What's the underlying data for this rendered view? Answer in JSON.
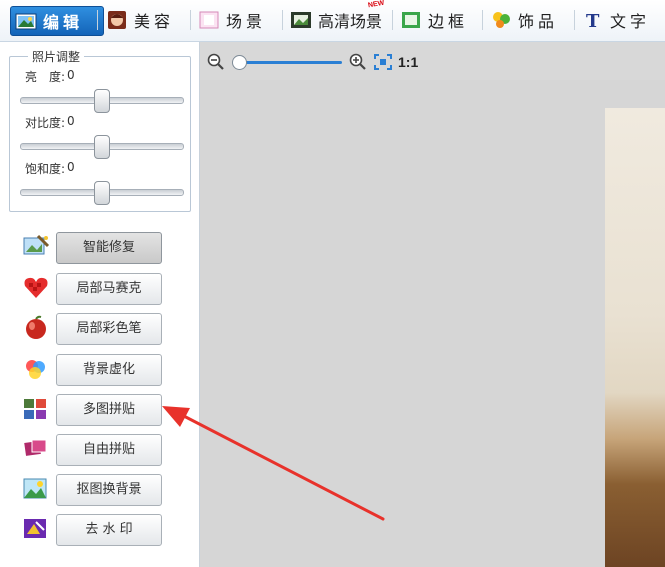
{
  "toolbar": {
    "tabs": [
      {
        "label": "编辑",
        "icon": "edit-photo-icon",
        "active": true
      },
      {
        "label": "美容",
        "icon": "beauty-face-icon"
      },
      {
        "label": "场景",
        "icon": "scene-frame-icon"
      },
      {
        "label": "高清场景",
        "icon": "hd-scene-icon",
        "badge": "NEW"
      },
      {
        "label": "边框",
        "icon": "border-frame-icon"
      },
      {
        "label": "饰品",
        "icon": "accessory-icon"
      },
      {
        "label": "文字",
        "icon": "text-t-icon"
      }
    ]
  },
  "adjust": {
    "title": "照片调整",
    "rows": [
      {
        "label": "亮　度:",
        "value": "0"
      },
      {
        "label": "对比度:",
        "value": "0"
      },
      {
        "label": "饱和度:",
        "value": "0"
      }
    ]
  },
  "tools": [
    {
      "label": "智能修复",
      "icon": "smart-repair-icon",
      "active": true
    },
    {
      "label": "局部马赛克",
      "icon": "mosaic-icon"
    },
    {
      "label": "局部彩色笔",
      "icon": "color-pen-icon"
    },
    {
      "label": "背景虚化",
      "icon": "background-blur-icon"
    },
    {
      "label": "多图拼贴",
      "icon": "multi-collage-icon"
    },
    {
      "label": "自由拼贴",
      "icon": "free-collage-icon"
    },
    {
      "label": "抠图换背景",
      "icon": "cutout-background-icon"
    },
    {
      "label": "去 水 印",
      "icon": "remove-watermark-icon"
    }
  ],
  "zoom": {
    "ratio_label": "1:1",
    "level": 0.05,
    "accent": "#2a7fd4"
  },
  "colors": {
    "active_tab": "#1f7bd0",
    "arrow": "#e8322b"
  }
}
